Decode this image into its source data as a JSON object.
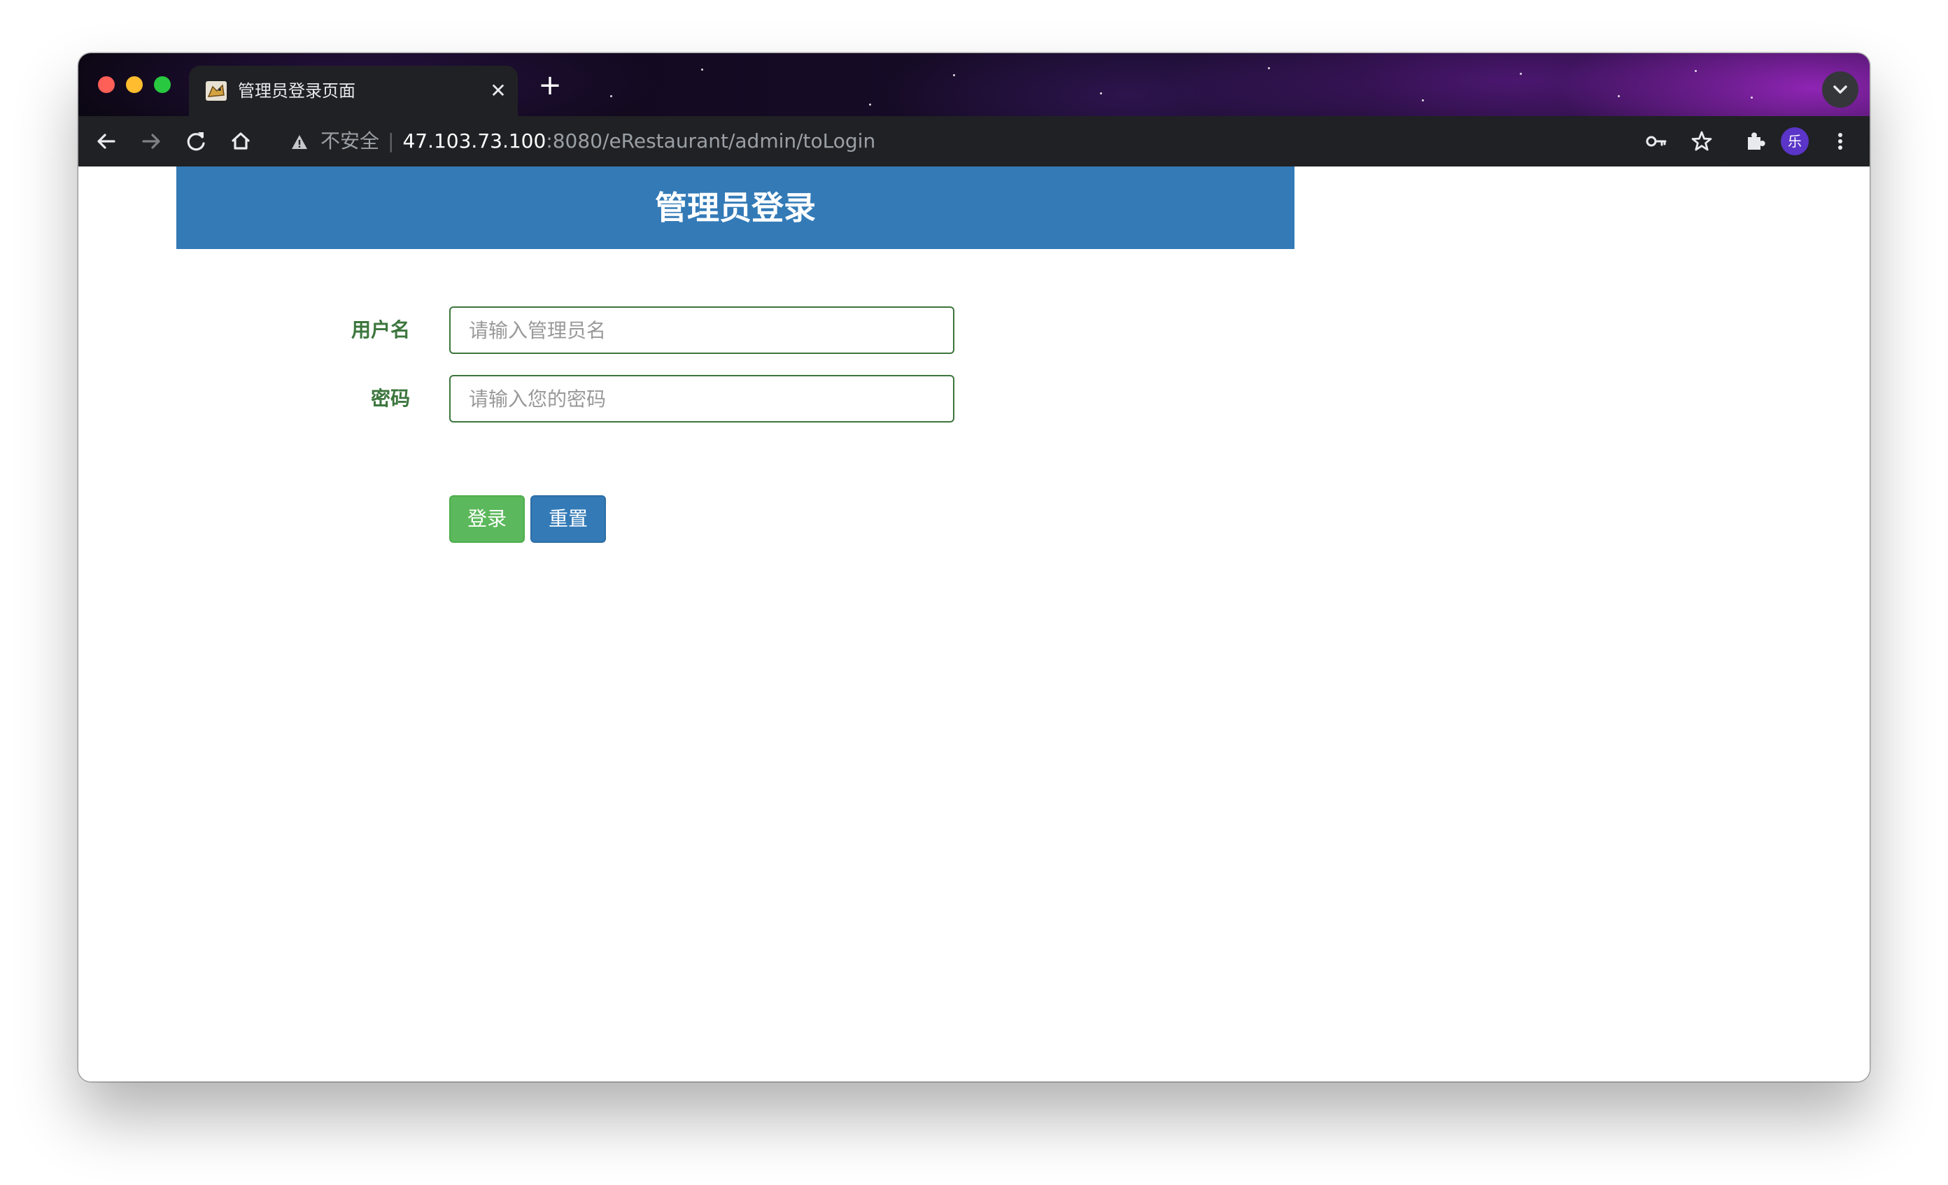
{
  "browser": {
    "tab": {
      "title": "管理员登录页面",
      "close_glyph": "✕",
      "favicon": "tomcat-favicon-icon"
    },
    "new_tab_glyph": "+",
    "address": {
      "security_label": "不安全",
      "url_host": "47.103.73.100",
      "url_rest": ":8080/eRestaurant/admin/toLogin"
    },
    "profile_initial": "乐"
  },
  "page": {
    "header_title": "管理员登录",
    "form": {
      "username_label": "用户名",
      "username_placeholder": "请输入管理员名",
      "username_value": "",
      "password_label": "密码",
      "password_placeholder": "请输入您的密码",
      "password_value": "",
      "login_button": "登录",
      "reset_button": "重置"
    }
  },
  "colors": {
    "banner": "#337ab7",
    "label_green": "#3c763d",
    "login_button": "#5cb85c",
    "reset_button": "#337ab7"
  }
}
